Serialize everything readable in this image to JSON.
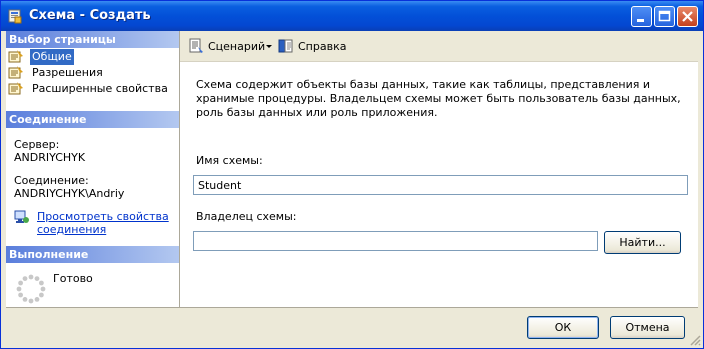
{
  "window": {
    "title": "Схема - Создать",
    "icon": "schema-icon",
    "controls": [
      "minimize-icon",
      "maximize-icon",
      "close-icon"
    ]
  },
  "left_pane": {
    "select_page_header": "Выбор страницы",
    "pages": [
      {
        "label": "Общие",
        "icon": "page-icon",
        "selected": true
      },
      {
        "label": "Разрешения",
        "icon": "page-icon",
        "selected": false
      },
      {
        "label": "Расширенные свойства",
        "icon": "page-icon",
        "selected": false
      }
    ],
    "connection_header": "Соединение",
    "server_label": "Сервер:",
    "server_value": "ANDRIYCHYK",
    "connection_label": "Соединение:",
    "connection_value": "ANDRIYCHYK\\Andriy",
    "view_properties_link_line1": "Просмотреть свойства",
    "view_properties_link_line2": "соединения",
    "progress_header": "Выполнение",
    "progress_status": "Готово"
  },
  "toolbar": {
    "script_label": "Сценарий",
    "help_label": "Справка"
  },
  "content": {
    "description": "Схема содержит объекты базы данных, такие как таблицы, представления и хранимые процедуры. Владельцем схемы может быть пользователь базы данных, роль базы данных или роль приложения.",
    "schema_name_label": "Имя схемы:",
    "schema_name_value": "Student",
    "owner_label": "Владелец схемы:",
    "owner_value": "",
    "search_button": "Найти..."
  },
  "footer": {
    "ok_button": "ОК",
    "cancel_button": "Отмена"
  },
  "colors": {
    "title_bar": "#0350d8",
    "section_header": "#5a7edc",
    "selection": "#316ac5",
    "link": "#0033cc",
    "dialog_bg": "#ece9d8"
  }
}
